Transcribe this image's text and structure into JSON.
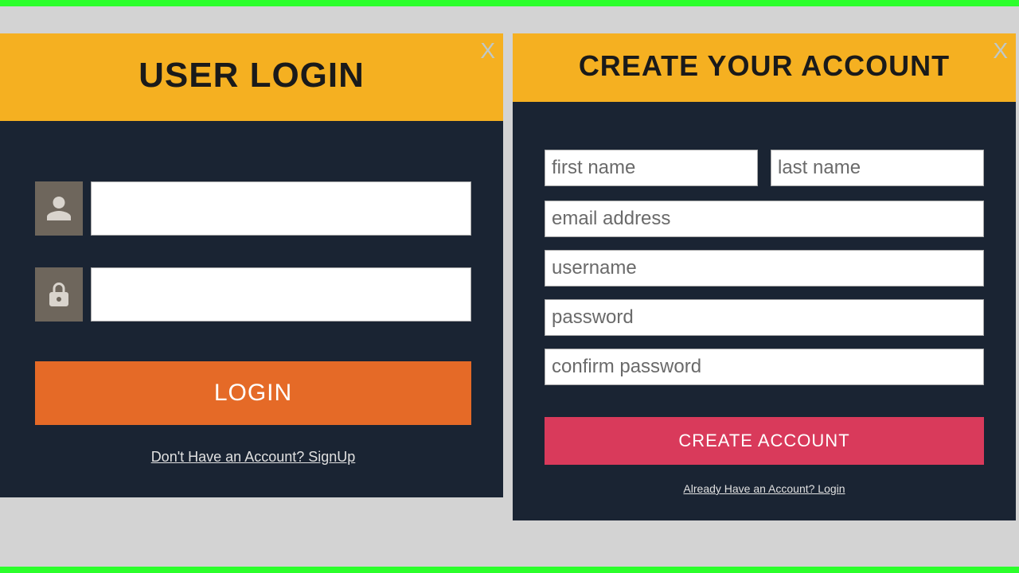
{
  "login": {
    "title": "USER LOGIN",
    "close": "X",
    "username_value": "",
    "password_value": "",
    "button": "LOGIN",
    "link": "Don't Have an Account? SignUp"
  },
  "signup": {
    "title": "CREATE YOUR ACCOUNT",
    "close": "X",
    "firstname_ph": "first name",
    "lastname_ph": "last name",
    "email_ph": "email address",
    "username_ph": "username",
    "password_ph": "password",
    "confirm_ph": "confirm password",
    "button": "CREATE ACCOUNT",
    "link": "Already Have an Account? Login"
  }
}
